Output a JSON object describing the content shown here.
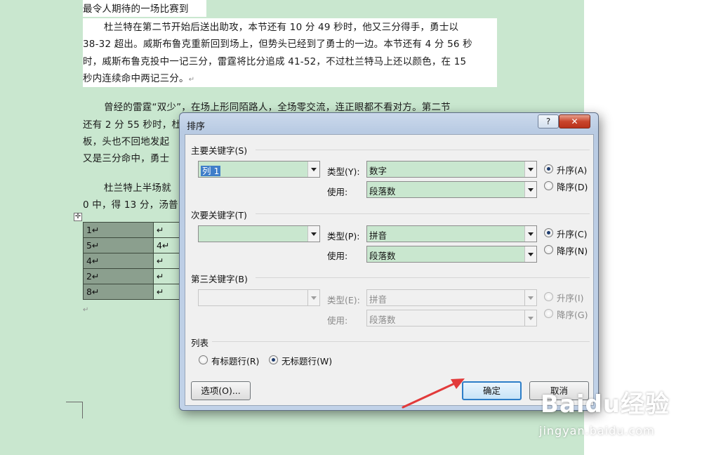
{
  "document": {
    "heading": "最令人期待的一场比赛到",
    "paragraph1": [
      "杜兰特在第二节开始后送出助攻，本节还有 10 分 49 秒时，他又三分得手，勇士以",
      "38-32 超出。威斯布鲁克重新回到场上，但势头已经到了勇士的一边。本节还有 4 分 56 秒",
      "时，威斯布鲁克投中一记三分，雷霆将比分追成 41-52，不过杜兰特马上还以颜色，在 15",
      "秒内连续命中两记三分。"
    ],
    "paragraph2": [
      "曾经的雷霆“双少”，在场上形同陌路人，全场零交流，连正眼都不看对方。第二节",
      "还有 2 分 55 秒时，杜",
      "板，头也不回地发起",
      "又是三分命中，勇士"
    ],
    "paragraph3": [
      "杜兰特上半场就",
      "0 中，得 13 分，汤普"
    ],
    "paragraph_mark": "↵",
    "table_rows": [
      {
        "col1": "1↵",
        "col2": "↵"
      },
      {
        "col1": "5↵",
        "col2": "4↵"
      },
      {
        "col1": "4↵",
        "col2": "↵"
      },
      {
        "col1": "2↵",
        "col2": "↵"
      },
      {
        "col1": "8↵",
        "col2": "↵"
      }
    ],
    "table_move_icon": "✛"
  },
  "dialog": {
    "title": "排序",
    "help_label": "?",
    "close_label": "✕",
    "primary": {
      "title": "主要关键字(S)",
      "column_value": "列 1",
      "type_label": "类型(Y):",
      "type_value": "数字",
      "use_label": "使用:",
      "use_value": "段落数",
      "asc_label": "升序(A)",
      "desc_label": "降序(D)",
      "order": "asc"
    },
    "secondary": {
      "title": "次要关键字(T)",
      "column_value": "",
      "type_label": "类型(P):",
      "type_value": "拼音",
      "use_label": "使用:",
      "use_value": "段落数",
      "asc_label": "升序(C)",
      "desc_label": "降序(N)",
      "order": "asc"
    },
    "tertiary": {
      "title": "第三关键字(B)",
      "column_value": "",
      "type_label": "类型(E):",
      "type_value": "拼音",
      "use_label": "使用:",
      "use_value": "段落数",
      "asc_label": "升序(I)",
      "desc_label": "降序(G)",
      "order": "asc"
    },
    "list": {
      "title": "列表",
      "header_label": "有标题行(R)",
      "no_header_label": "无标题行(W)",
      "selected": "no_header"
    },
    "options_button": "选项(O)...",
    "ok_button": "确定",
    "cancel_button": "取消"
  },
  "watermark": {
    "brand": "Baidu经验",
    "url": "jingyan.baidu.com"
  },
  "colors": {
    "page_bg": "#c9e7cf",
    "selection": "#3f7ec9",
    "arrow": "#e23a3a"
  }
}
